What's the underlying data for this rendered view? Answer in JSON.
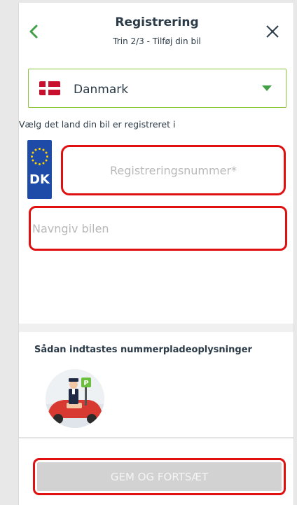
{
  "header": {
    "title": "Registrering",
    "subtitle": "Trin 2/3 - Tilføj din bil"
  },
  "country_select": {
    "label": "Danmark",
    "flag_icon": "denmark-flag-icon",
    "hint": "Vælg det land din bil er registreret i"
  },
  "plate": {
    "country_code": "DK",
    "color": "#1e4aa8"
  },
  "form": {
    "registration_placeholder": "Registreringsnummer*",
    "name_placeholder": "Navngiv bilen"
  },
  "help": {
    "title": "Sådan indtastes nummerpladeoplysninger"
  },
  "footer": {
    "save_label": "GEM OG FORTSÆT"
  },
  "colors": {
    "accent_green": "#43a047",
    "highlight_red": "#e01010",
    "text_dark": "#2b3a47"
  }
}
